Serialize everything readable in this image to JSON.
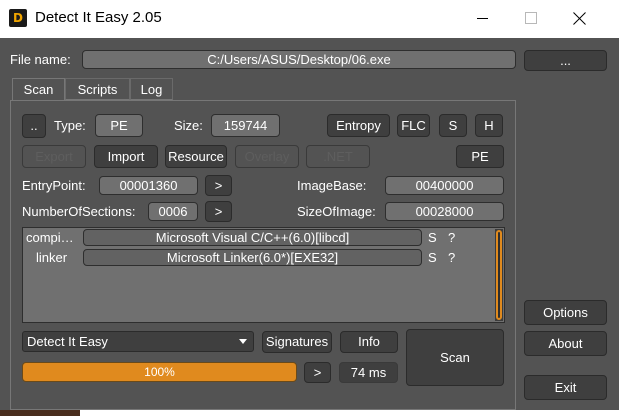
{
  "window": {
    "title": "Detect It Easy 2.05",
    "icon_text": "DiE"
  },
  "file": {
    "label": "File name:",
    "path": "C:/Users/ASUS/Desktop/06.exe",
    "browse": "..."
  },
  "tabs": [
    "Scan",
    "Scripts",
    "Log"
  ],
  "row1": {
    "up": "..",
    "type_label": "Type:",
    "type_value": "PE",
    "size_label": "Size:",
    "size_value": "159744",
    "entropy": "Entropy",
    "flc": "FLC",
    "s": "S",
    "h": "H"
  },
  "row2": {
    "export": "Export",
    "import": "Import",
    "resource": "Resource",
    "overlay": "Overlay",
    "net": ".NET",
    "pe": "PE"
  },
  "row3": {
    "entry_label": "EntryPoint:",
    "entry_value": "00001360",
    "image_base_label": "ImageBase:",
    "image_base_value": "00400000"
  },
  "row4": {
    "sections_label": "NumberOfSections:",
    "sections_value": "0006",
    "image_size_label": "SizeOfImage:",
    "image_size_value": "00028000"
  },
  "arrow": ">",
  "results": [
    {
      "type": "compi…",
      "name": "Microsoft Visual C/C++(6.0)[libcd]",
      "s": "S",
      "q": "?"
    },
    {
      "type": "linker",
      "name": "Microsoft Linker(6.0*)[EXE32]",
      "s": "S",
      "q": "?"
    }
  ],
  "bottom": {
    "engine": "Detect It Easy",
    "signatures": "Signatures",
    "info": "Info",
    "scan": "Scan",
    "progress": "100%",
    "progress_value": 100,
    "time": "74 ms"
  },
  "side": {
    "options": "Options",
    "about": "About",
    "exit": "Exit"
  },
  "colors": {
    "accent": "#e08a1e",
    "background": "#535353",
    "field": "#707070"
  }
}
